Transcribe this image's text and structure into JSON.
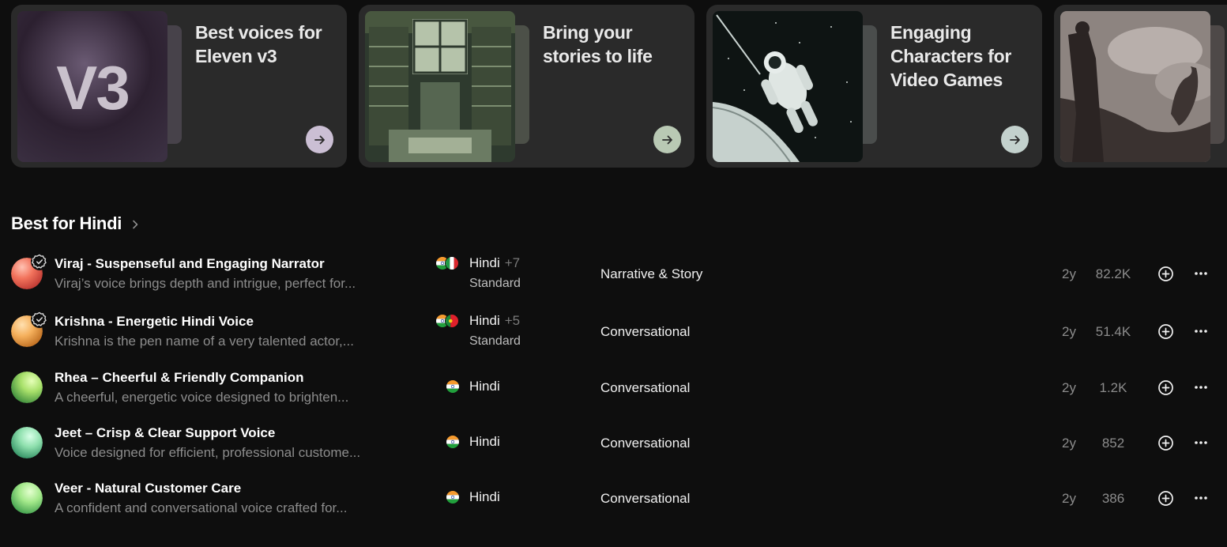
{
  "collections": [
    {
      "title": "Best voices for Eleven v3",
      "thumb_text": "V3",
      "thumb_icon": "v3-logo",
      "button_color": "#cbbfd4"
    },
    {
      "title": "Bring your stories to life",
      "thumb_icon": "library-illustration",
      "button_color": "#b9c9b4"
    },
    {
      "title": "Engaging Characters for Video Games",
      "thumb_icon": "astronaut-illustration",
      "button_color": "#c3d1cd"
    },
    {
      "title": "",
      "thumb_icon": "warrior-dragon-illustration",
      "button_color": "#c9bebb"
    }
  ],
  "section": {
    "title": "Best for Hindi",
    "icon": "chevron-right-icon"
  },
  "voices": [
    {
      "name": "Viraj - Suspenseful and Engaging Narrator",
      "description": "Viraj’s voice brings depth and intrigue, perfect for...",
      "verified": true,
      "avatar_colors": [
        "#f2735c",
        "#c23f3a"
      ],
      "flags": [
        "india",
        "italy"
      ],
      "language": "Hindi",
      "language_more": "+7",
      "model": "Standard",
      "category": "Narrative & Story",
      "age": "2y",
      "users": "82.2K"
    },
    {
      "name": "Krishna - Energetic Hindi Voice",
      "description": "Krishna is the pen name of a very talented actor,...",
      "verified": true,
      "avatar_colors": [
        "#f5b05c",
        "#c5731f"
      ],
      "flags": [
        "india",
        "portugal"
      ],
      "language": "Hindi",
      "language_more": "+5",
      "model": "Standard",
      "category": "Conversational",
      "age": "2y",
      "users": "51.4K"
    },
    {
      "name": "Rhea – Cheerful & Friendly Companion",
      "description": "A cheerful, energetic voice designed to brighten...",
      "verified": false,
      "avatar_colors": [
        "#a8e06a",
        "#2f8d3c"
      ],
      "flags": [
        "india"
      ],
      "language": "Hindi",
      "language_more": "",
      "model": "",
      "category": "Conversational",
      "age": "2y",
      "users": "1.2K"
    },
    {
      "name": "Jeet – Crisp & Clear Support Voice",
      "description": "Voice designed for efficient, professional custome...",
      "verified": false,
      "avatar_colors": [
        "#8fe0ae",
        "#1f8a5b"
      ],
      "flags": [
        "india"
      ],
      "language": "Hindi",
      "language_more": "",
      "model": "",
      "category": "Conversational",
      "age": "2y",
      "users": "852"
    },
    {
      "name": "Veer - Natural Customer Care",
      "description": "A confident and conversational voice crafted for...",
      "verified": false,
      "avatar_colors": [
        "#a3e88a",
        "#2f9a45"
      ],
      "flags": [
        "india"
      ],
      "language": "Hindi",
      "language_more": "",
      "model": "",
      "category": "Conversational",
      "age": "2y",
      "users": "386"
    }
  ],
  "row_actions": {
    "add_icon": "plus-circle-icon",
    "more_icon": "more-horizontal-icon"
  }
}
